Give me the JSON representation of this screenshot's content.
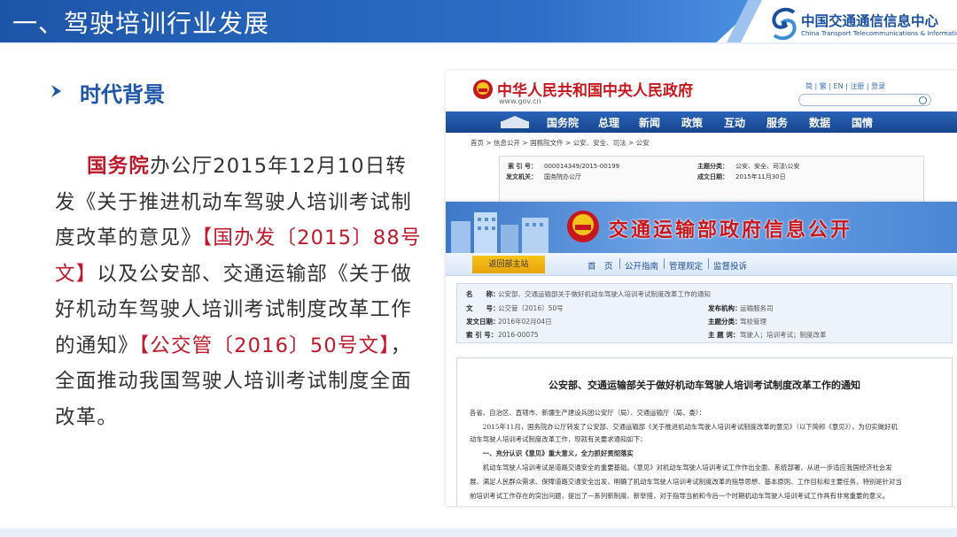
{
  "header": {
    "title": "一、驾驶培训行业发展",
    "logo_cn": "中国交通通信信息中心",
    "logo_en": "China Transport Telecommunications & Information Center"
  },
  "section": {
    "heading": "时代背景"
  },
  "body": {
    "p1_red": "国务院",
    "p1_a": "办公厅2015年12月10日转发《关于推进机动车驾驶人培训考试制度改革的意见》",
    "p1_ref1": "【国办发〔2015〕88号文】",
    "p1_b": "以及公安部、交通运输部《关于做好机动车驾驶人培训考试制度改革工作的通知》",
    "p1_ref2": "【公交管〔2016〕50号文】",
    "p1_c": "，全面推动我国驾驶人培训考试制度全面改革。"
  },
  "gov_site": {
    "name": "中华人民共和国中央人民政府",
    "url": "www.gov.cn",
    "tools": "简 | 繁 | EN | 注册 | 登录",
    "nav": [
      "国务院",
      "总理",
      "新闻",
      "政策",
      "互动",
      "服务",
      "数据",
      "国情"
    ],
    "breadcrumb": "首页 > 信息公开 > 国務院文件 > 公安、安全、司法 > 公安",
    "meta": [
      {
        "k": "索 引 号：",
        "v": "000014349/2015-00199"
      },
      {
        "k": "发文机关：",
        "v": "国务院办公厅"
      },
      {
        "k": "主题分类：",
        "v": "公安、安全、司法\\公安"
      },
      {
        "k": "成文日期：",
        "v": "2015年11月30日"
      }
    ]
  },
  "mot_site": {
    "title": "交通运输部政府信息公开",
    "home_button": "返回部主站",
    "nav": [
      "首　页",
      "公开指南",
      "管理规定",
      "监督投诉"
    ],
    "meta": [
      {
        "k": "名　　称：",
        "v": "公安部、交通运输部关于做好机动车驾驶人培训考试制度改革工作的通知"
      },
      {
        "k": "文　　号：",
        "v": "公交管〔2016〕50号"
      },
      {
        "k": "发文日期：",
        "v": "2016年02月04日"
      },
      {
        "k": "索 引 号：",
        "v": "2016-00075"
      },
      {
        "k": "发布机构：",
        "v": "运输服务司"
      },
      {
        "k": "主题分类：",
        "v": "驾校管理"
      },
      {
        "k": "主 题 词：",
        "v": "驾驶人；培训考试；制度改革"
      }
    ],
    "doc_title": "公安部、交通运输部关于做好机动车驾驶人培训考试制度改革工作的通知",
    "doc_lines": [
      "各省、自治区、直辖市、新疆生产建设兵团公安厅（局）、交通运输厅（局、委）：",
      "　　2015年11月，国务院办公厅转发了公安部、交通运输部《关于推进机动车驾驶人培训考试制度改革的意见》（以下简称《意见》），为切实做好机",
      "动车驾驶人培训考试制度改革工作，现就有关要求通知如下：",
      "　　一、充分认识《意见》重大意义，全力抓好贯彻落实",
      "　　机动车驾驶人培训考试是道路交通安全的重要基础。《意见》对机动车驾驶人培训考试工作作出全面、系统部署，从进一步适应我国经济社会发",
      "展、满足人民群众需求、保障道路交通安全出发，明确了机动车驾驶人培训考试制度改革的指导思想、基本原则、工作目标和主要任务，特别是针对当",
      "前培训考试工作存在的突出问题，提出了一系列新制度、新举措，对于指导当前和今后一个时期机动车驾驶人培训考试工作具有非常重要的意义。"
    ]
  },
  "colors": {
    "brand_blue": "#1d55a8",
    "accent_red": "#c0192b"
  }
}
